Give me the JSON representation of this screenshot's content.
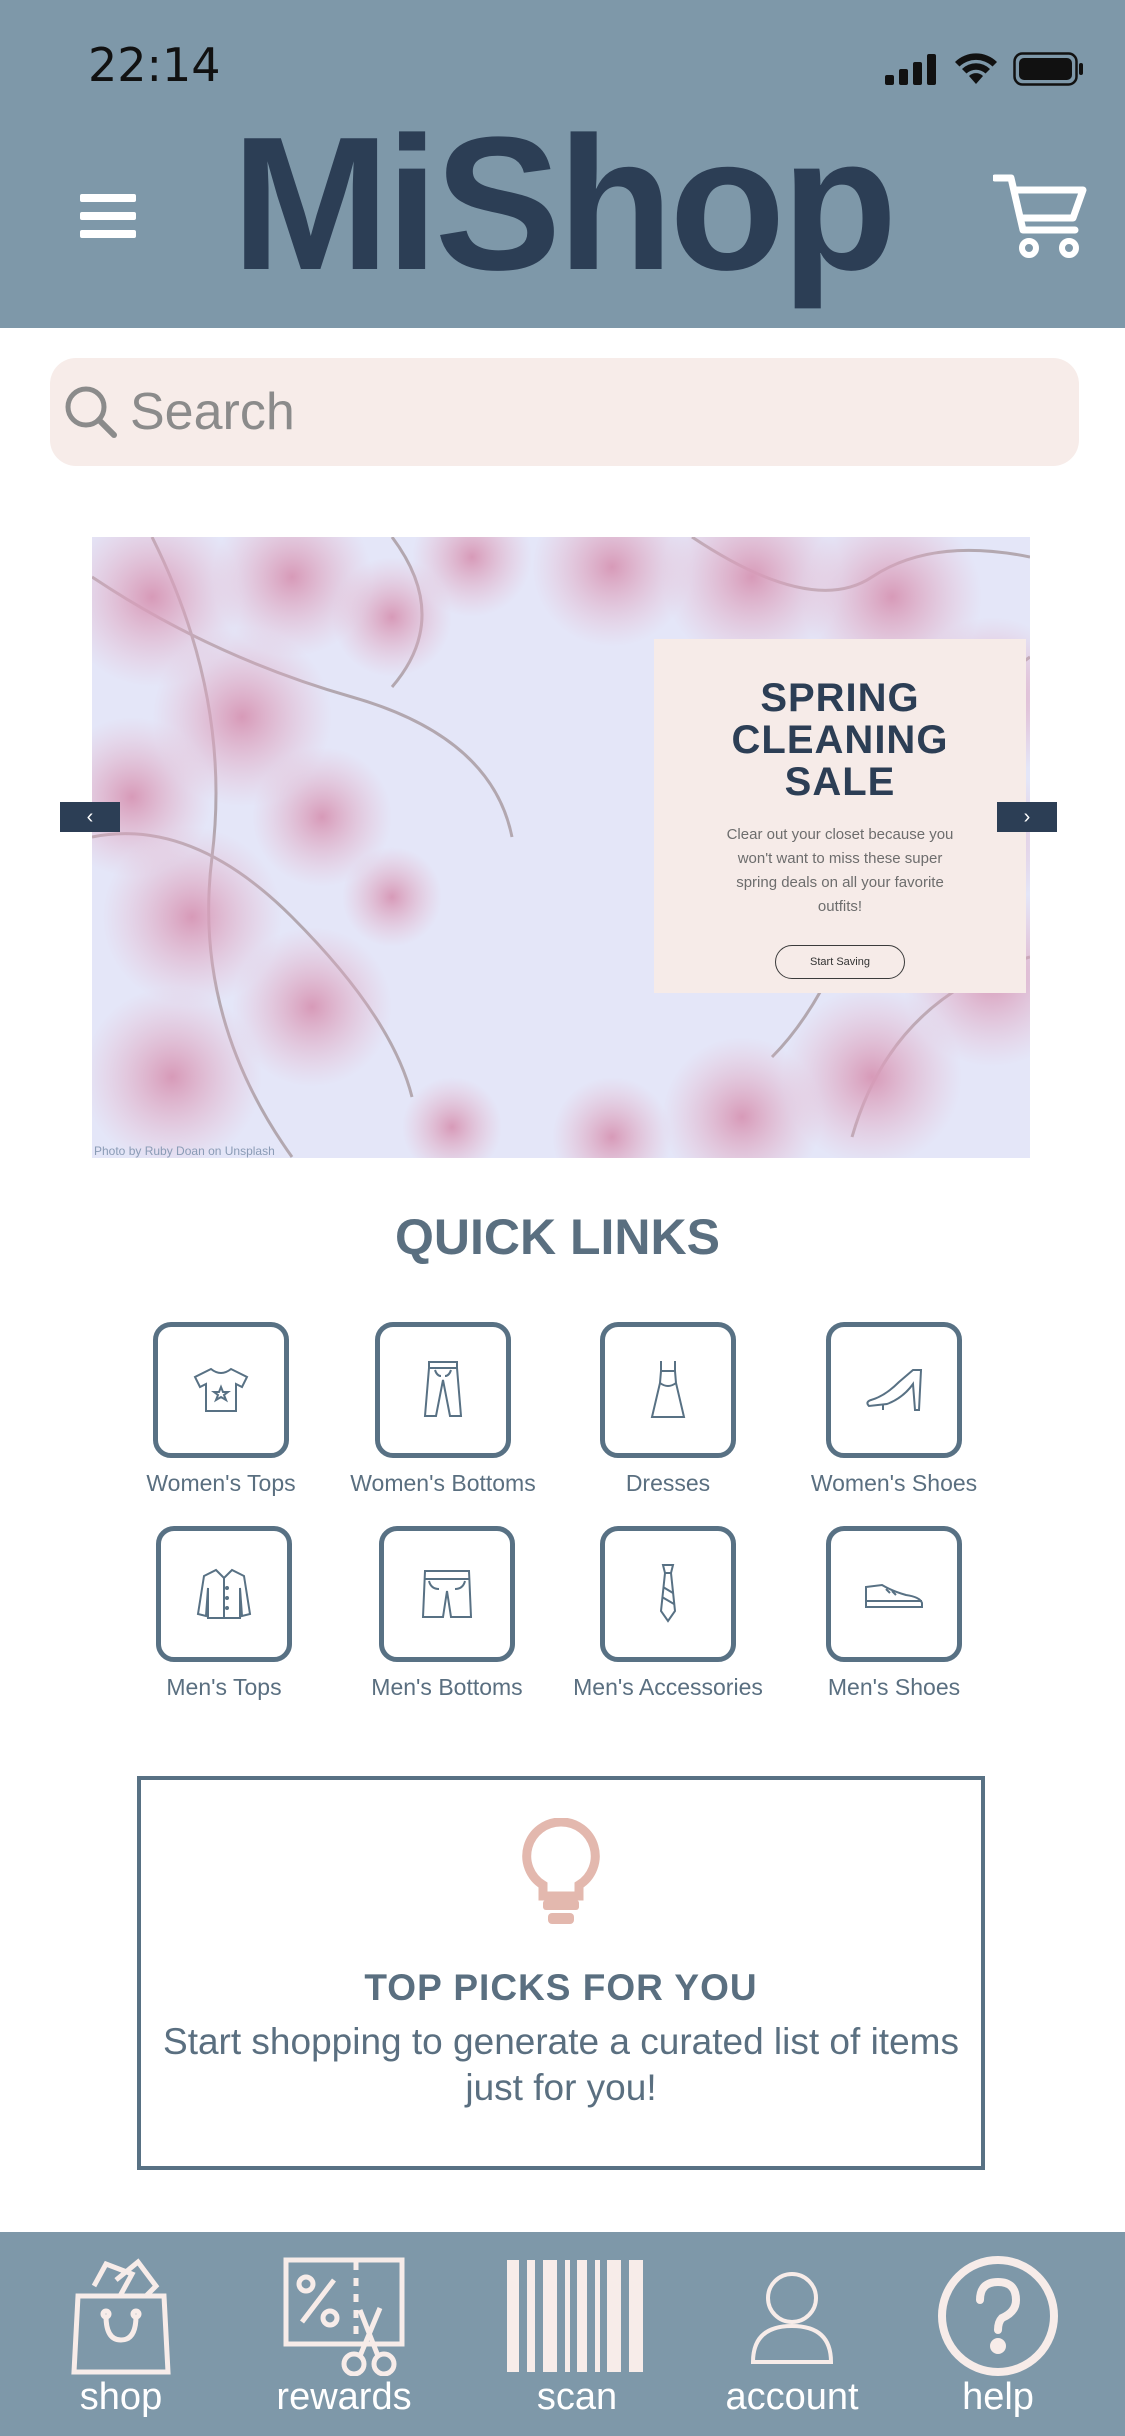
{
  "status_bar": {
    "time": "22:14"
  },
  "header": {
    "brand": "MiShop"
  },
  "search": {
    "placeholder": "Search"
  },
  "banner": {
    "title_lines": [
      "SPRING",
      "CLEANING",
      "SALE"
    ],
    "text": "Clear out your closet because you won't want to miss these super spring deals on all your favorite outfits!",
    "button_label": "Start Saving",
    "photo_credit": "Photo by Ruby Doan on Unsplash",
    "prev_label": "‹",
    "next_label": "›"
  },
  "quick_links": {
    "title": "QUICK LINKS",
    "items": [
      {
        "label": "Women's Tops",
        "icon": "womens-top-icon"
      },
      {
        "label": "Women's Bottoms",
        "icon": "womens-bottoms-icon"
      },
      {
        "label": "Dresses",
        "icon": "dress-icon"
      },
      {
        "label": "Women's Shoes",
        "icon": "heel-shoe-icon"
      },
      {
        "label": "Men's Tops",
        "icon": "mens-shirt-icon"
      },
      {
        "label": "Men's Bottoms",
        "icon": "shorts-icon"
      },
      {
        "label": "Men's Accessories",
        "icon": "tie-icon"
      },
      {
        "label": "Men's Shoes",
        "icon": "mens-shoe-icon"
      }
    ]
  },
  "top_picks": {
    "title": "TOP PICKS FOR YOU",
    "text": "Start shopping to generate a curated list of items just for you!"
  },
  "bottom_nav": {
    "items": [
      {
        "label": "shop",
        "icon": "shopping-bag-icon"
      },
      {
        "label": "rewards",
        "icon": "coupon-icon"
      },
      {
        "label": "scan",
        "icon": "barcode-icon"
      },
      {
        "label": "account",
        "icon": "user-icon"
      },
      {
        "label": "help",
        "icon": "help-icon"
      }
    ]
  },
  "colors": {
    "header_bg": "#7e98a9",
    "brand_text": "#2c3e55",
    "accent_slate": "#587184",
    "search_bg": "#f7ece9",
    "bulb": "#e3b8ae"
  }
}
